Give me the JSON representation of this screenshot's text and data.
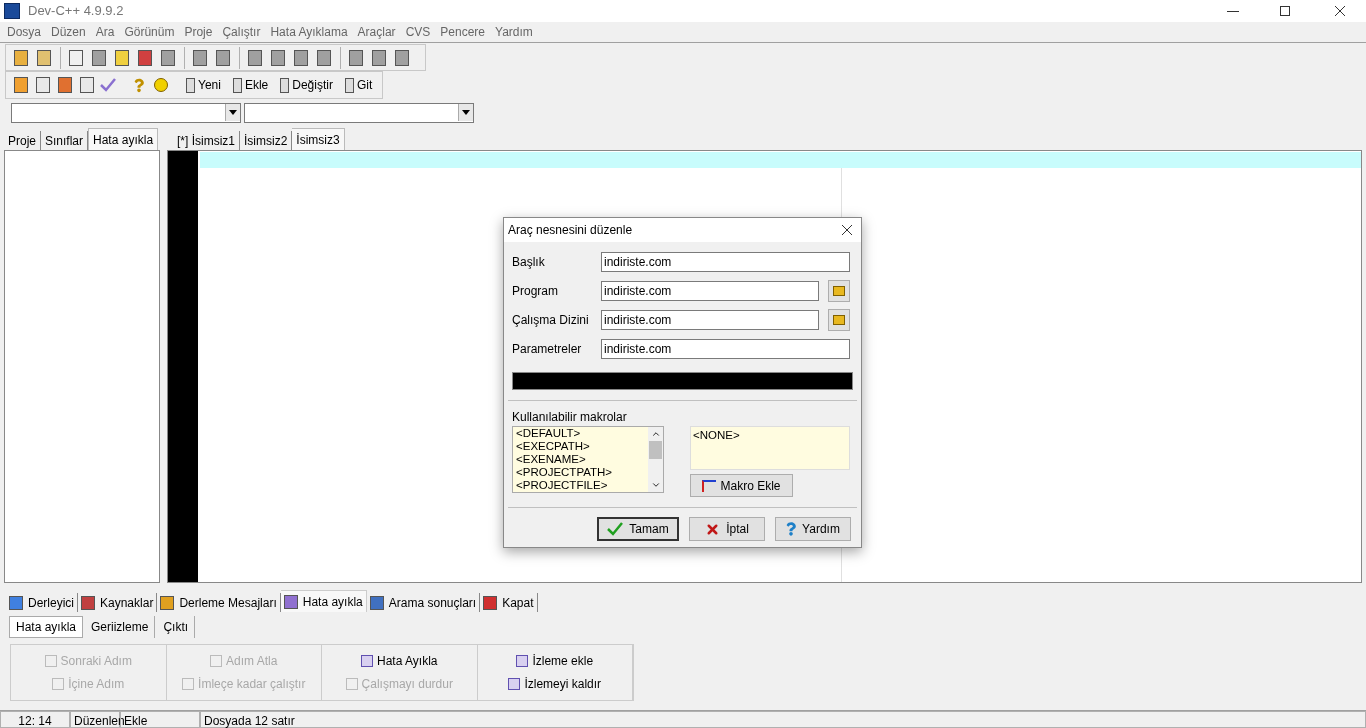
{
  "window": {
    "title": "Dev-C++ 4.9.9.2"
  },
  "menu": [
    "Dosya",
    "Düzen",
    "Ara",
    "Görünüm",
    "Proje",
    "Çalıştır",
    "Hata Ayıklama",
    "Araçlar",
    "CVS",
    "Pencere",
    "Yardım"
  ],
  "toolbar_1": [
    [
      {
        "disabled": false
      },
      {
        "disabled": false
      }
    ],
    [
      {
        "disabled": false
      },
      {
        "disabled": true
      },
      {
        "disabled": false
      },
      {
        "disabled": false
      },
      {
        "disabled": true
      }
    ],
    [
      {
        "disabled": true
      },
      {
        "disabled": true
      }
    ],
    [
      {
        "disabled": true
      },
      {
        "disabled": true
      },
      {
        "disabled": true
      },
      {
        "disabled": true
      }
    ],
    [
      {
        "disabled": true
      },
      {
        "disabled": true
      },
      {
        "disabled": true
      }
    ]
  ],
  "toolbar_2": [
    {
      "label": "Yeni"
    },
    {
      "label": "Ekle"
    },
    {
      "label": "Değiştir"
    },
    {
      "label": "Git"
    }
  ],
  "left_tabs": [
    {
      "label": "Proje",
      "selected": false
    },
    {
      "label": "Sınıflar",
      "selected": false
    },
    {
      "label": "Hata ayıkla",
      "selected": true
    }
  ],
  "editor_tabs": [
    {
      "label": "[*] İsimsiz1",
      "selected": false
    },
    {
      "label": "İsimsiz2",
      "selected": false
    },
    {
      "label": "İsimsiz3",
      "selected": true
    }
  ],
  "bottom_tabs": [
    {
      "label": "Derleyici",
      "selected": false
    },
    {
      "label": "Kaynaklar",
      "selected": false
    },
    {
      "label": "Derleme Mesajları",
      "selected": false
    },
    {
      "label": "Hata ayıkla",
      "selected": true
    },
    {
      "label": "Arama sonuçları",
      "selected": false
    },
    {
      "label": "Kapat",
      "selected": false
    }
  ],
  "debug_tabs": [
    {
      "label": "Hata ayıkla",
      "selected": true
    },
    {
      "label": "Geriizleme",
      "selected": false
    },
    {
      "label": "Çıktı",
      "selected": false
    }
  ],
  "debug_buttons": [
    [
      {
        "label": "Sonraki Adım",
        "disabled": true
      },
      {
        "label": "İçine Adım",
        "disabled": true
      }
    ],
    [
      {
        "label": "Adım Atla",
        "disabled": true
      },
      {
        "label": "İmleçe kadar çalıştır",
        "disabled": true
      }
    ],
    [
      {
        "label": "Hata Ayıkla",
        "disabled": false
      },
      {
        "label": "Çalışmayı durdur",
        "disabled": true
      }
    ],
    [
      {
        "label": "İzleme ekle",
        "disabled": false
      },
      {
        "label": "İzlemeyi kaldır",
        "disabled": false
      }
    ]
  ],
  "dialog": {
    "title": "Araç nesnesini düzenle",
    "fields": [
      {
        "label": "Başlık",
        "value": "indiriste.com",
        "browse": false
      },
      {
        "label": "Program",
        "value": "indiriste.com",
        "browse": true
      },
      {
        "label": "Çalışma Dizini",
        "value": "indiriste.com",
        "browse": true
      },
      {
        "label": "Parametreler",
        "value": "indiriste.com",
        "browse": false
      }
    ],
    "macros_label": "Kullanılabilir makrolar",
    "macros": [
      "<DEFAULT>",
      "<EXECPATH>",
      "<EXENAME>",
      "<PROJECTPATH>",
      "<PROJECTFILE>"
    ],
    "macro_preview": "<NONE>",
    "add_macro": "Makro Ekle",
    "buttons": [
      {
        "label": "Tamam",
        "kind": "ok"
      },
      {
        "label": "İptal",
        "kind": "cancel"
      },
      {
        "label": "Yardım",
        "kind": "help"
      }
    ]
  },
  "status_bar": [
    "12: 14",
    "Düzenlen",
    "Ekle",
    "Dosyada 12 satır"
  ]
}
